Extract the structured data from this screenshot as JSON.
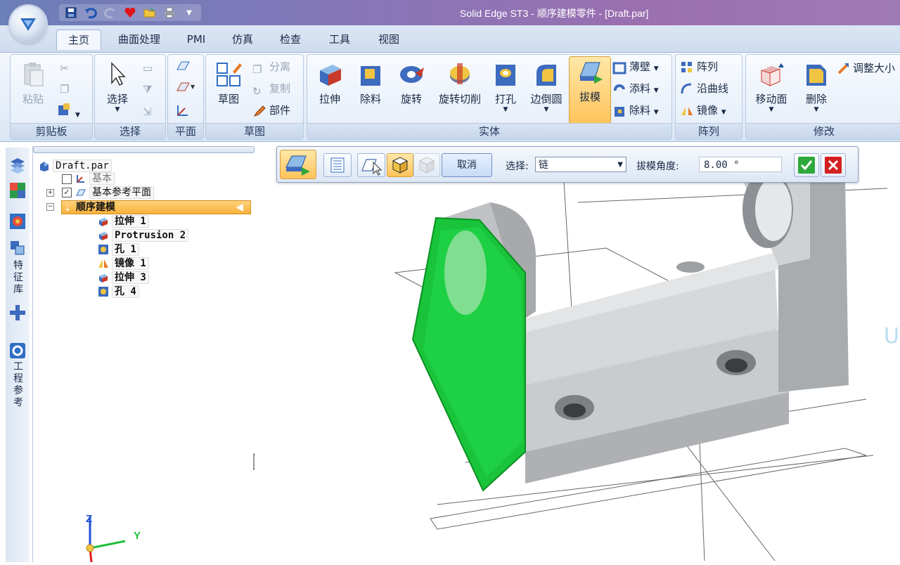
{
  "window": {
    "title": "Solid Edge ST3 - 顺序建模零件 - [Draft.par]"
  },
  "qat": {
    "icons": [
      "save-icon",
      "undo-icon",
      "redo-icon",
      "heart-icon",
      "open-folder-icon",
      "print-icon",
      "customize-icon"
    ]
  },
  "tabs": [
    "主页",
    "曲面处理",
    "PMI",
    "仿真",
    "检查",
    "工具",
    "视图"
  ],
  "ribbon": {
    "clipboard": {
      "label": "剪贴板",
      "paste": "粘贴"
    },
    "select": {
      "label": "选择",
      "select": "选择"
    },
    "plane": {
      "label": "平面"
    },
    "sketch": {
      "label": "草图",
      "sketch": "草图",
      "separate": "分离",
      "copy": "复制",
      "part": "部件"
    },
    "solids": {
      "label": "实体",
      "extrude": "拉伸",
      "cutout": "除料",
      "revolve": "旋转",
      "revolved_cutout": "旋转切削",
      "hole": "打孔",
      "round": "边倒圆",
      "draft": "拔模",
      "thin_wall": "薄壁",
      "add": "添料",
      "remove": "除料"
    },
    "pattern": {
      "label": "阵列",
      "pattern": "阵列",
      "along_curve": "沿曲线",
      "mirror": "镜像"
    },
    "modify": {
      "label": "修改",
      "move_face": "移动面",
      "delete": "删除",
      "resize": "调整大小"
    }
  },
  "command_bar": {
    "cancel": "取消",
    "select_label": "选择:",
    "select_value": "链",
    "angle_label": "拔模角度:",
    "angle_value": "8.00 °"
  },
  "dock_tabs": {
    "feature_library": "特征库",
    "engineering_ref": "工程参考"
  },
  "tree": {
    "root": "Draft.par",
    "base": "基本",
    "base_ref_planes": "基本参考平面",
    "ordered": "顺序建模",
    "features": [
      "拉伸 1",
      "Protrusion 2",
      "孔 1",
      "镜像 1",
      "拉伸 3",
      "孔 4"
    ]
  },
  "axes": {
    "z": "Z",
    "y": "Y"
  },
  "colors": {
    "accent": "#ffc35a",
    "selection_green": "#17c93a",
    "ribbon": "#dbe6f4",
    "model_gray": "#b9bcc0"
  }
}
